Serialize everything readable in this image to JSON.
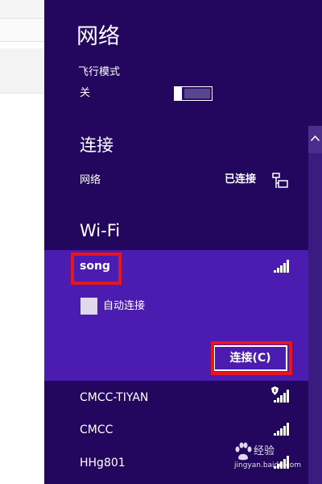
{
  "panel": {
    "title": "网络",
    "airplane": {
      "label": "飞行模式",
      "state": "关"
    },
    "connections": {
      "heading": "连接",
      "network_label": "网络",
      "network_status": "已连接"
    },
    "wifi": {
      "heading": "Wi-Fi",
      "selected": {
        "name": "song",
        "auto_connect_label": "自动连接",
        "connect_button": "连接(C)"
      },
      "others": [
        {
          "name": "CMCC-TIYAN",
          "secured": true
        },
        {
          "name": "CMCC",
          "secured": false
        },
        {
          "name": "HHg801",
          "secured": false
        }
      ]
    }
  },
  "watermark": {
    "text": "经验",
    "url": "jingyan.baidu.com"
  },
  "colors": {
    "panel_bg": "#23075f",
    "selected_bg": "#4c1cb0",
    "highlight": "#e8151f"
  }
}
